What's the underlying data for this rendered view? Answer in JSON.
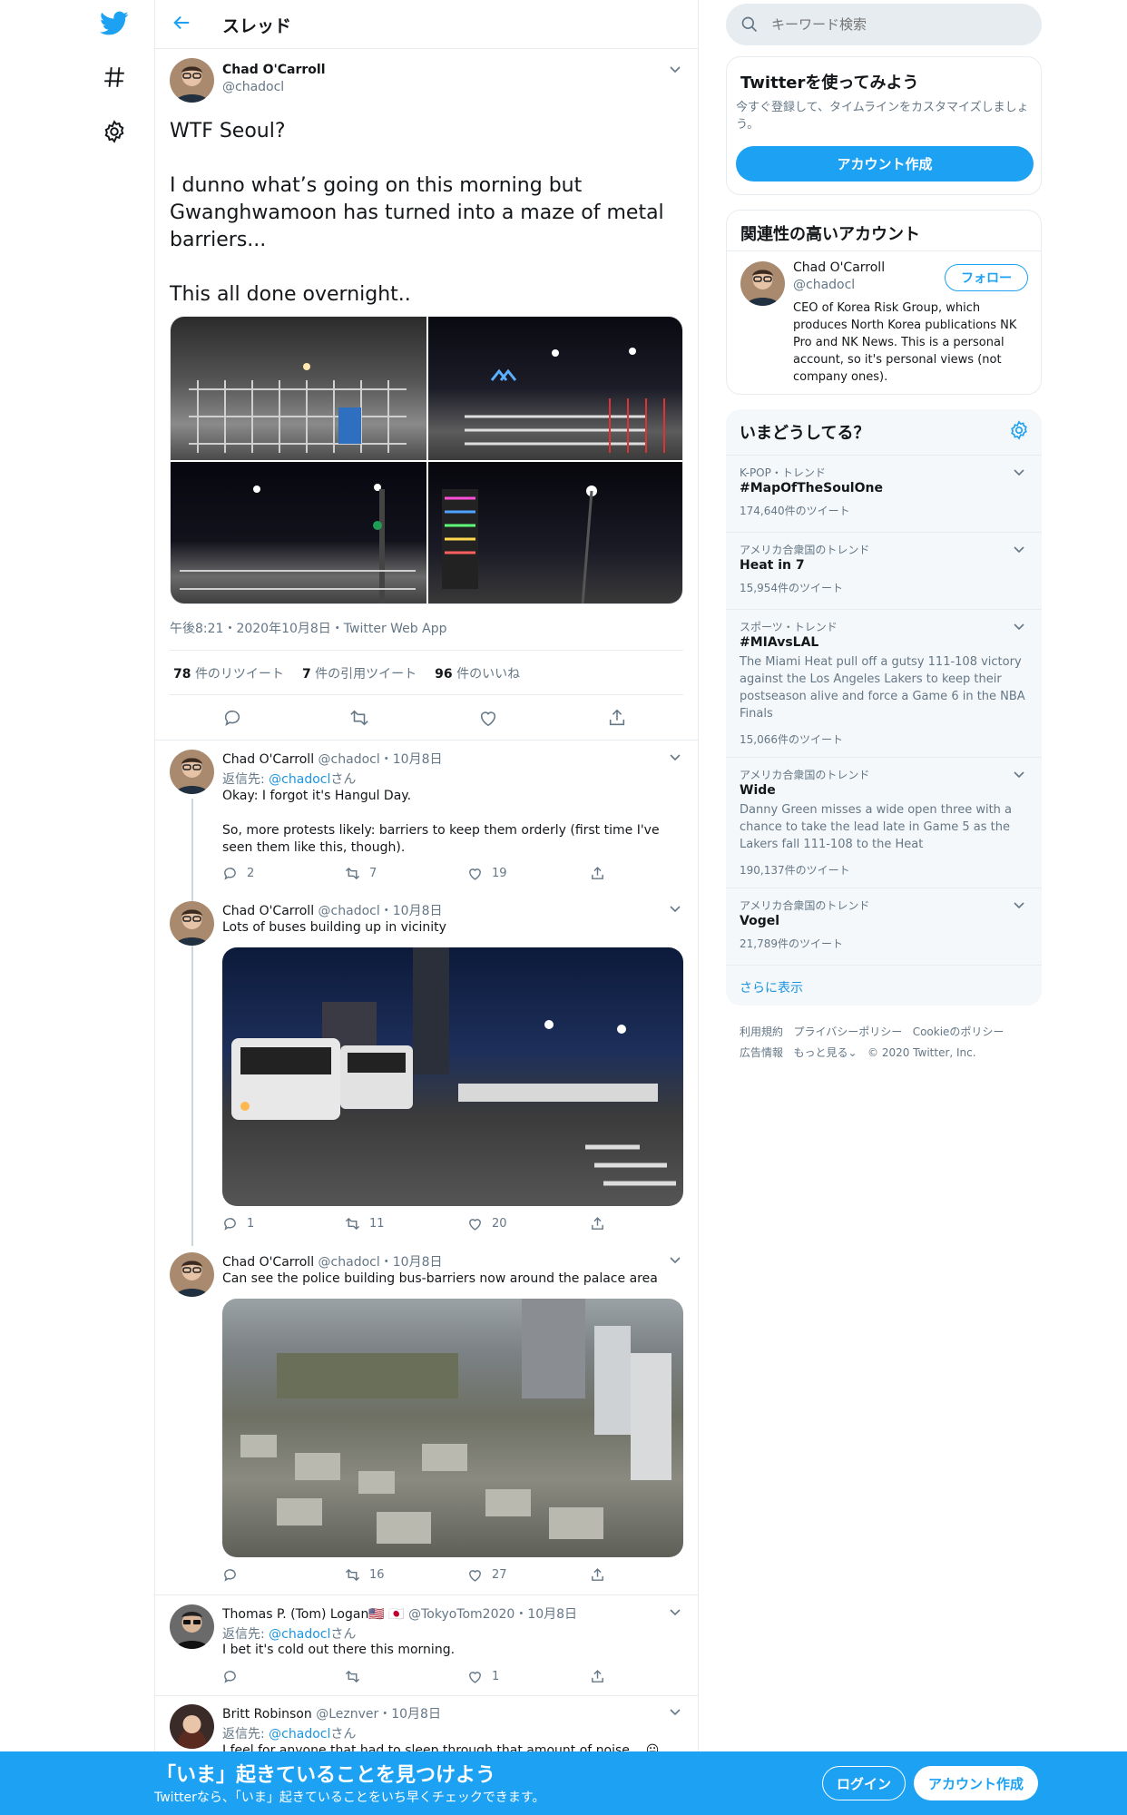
{
  "header": {
    "title": "スレッド"
  },
  "search": {
    "placeholder": "キーワード検索"
  },
  "main_tweet": {
    "name": "Chad O'Carroll",
    "handle": "@chadocl",
    "text_1": "WTF Seoul?",
    "text_2": "I dunno what’s going on this morning but Gwanghwamoon has turned into a maze of metal barriers...",
    "text_3": "This all done overnight..",
    "meta": "午後8:21・2020年10月8日・Twitter Web App",
    "stats": {
      "retweets_num": "78",
      "retweets_label": "件のリツイート",
      "quotes_num": "7",
      "quotes_label": "件の引用ツイート",
      "likes_num": "96",
      "likes_label": "件のいいね"
    }
  },
  "replies": [
    {
      "name": "Chad O'Carroll",
      "handle": "@chadocl",
      "date": "10月8日",
      "reply_prefix": "返信先:",
      "reply_to": "@chadocl",
      "reply_suffix": "さん",
      "text_1": "Okay: I forgot it's Hangul Day.",
      "text_2": "So, more protests likely: barriers to keep them orderly (first time I've seen them like this, though).",
      "replies": "2",
      "retweets": "7",
      "likes": "19"
    },
    {
      "name": "Chad O'Carroll",
      "handle": "@chadocl",
      "date": "10月8日",
      "text_1": "Lots of buses building up in vicinity",
      "replies": "1",
      "retweets": "11",
      "likes": "20"
    },
    {
      "name": "Chad O'Carroll",
      "handle": "@chadocl",
      "date": "10月8日",
      "text_1": "Can see the police building bus-barriers now around the palace area",
      "replies": "",
      "retweets": "16",
      "likes": "27"
    },
    {
      "name": "Thomas P. (Tom) Logan",
      "flags": "🇺🇸 🇯🇵",
      "handle": "@TokyoTom2020",
      "date": "10月8日",
      "reply_prefix": "返信先:",
      "reply_to": "@chadocl",
      "reply_suffix": "さん",
      "text_1": "I bet it's cold out there this morning.",
      "replies": "",
      "retweets": "",
      "likes": "1"
    },
    {
      "name": "Britt Robinson",
      "handle": "@Leznver",
      "date": "10月8日",
      "reply_prefix": "返信先:",
      "reply_to": "@chadocl",
      "reply_suffix": "さん",
      "text_1": "I feel for anyone that had to sleep through that amount of noise... 😐"
    }
  ],
  "signup_card": {
    "title": "Twitterを使ってみよう",
    "desc": "今すぐ登録して、タイムラインをカスタマイズしましょう。",
    "button": "アカウント作成"
  },
  "related": {
    "title": "関連性の高いアカウント",
    "name": "Chad O'Carroll",
    "handle": "@chadocl",
    "follow": "フォロー",
    "bio": "CEO of Korea Risk Group, which produces North Korea publications NK Pro and NK News. This is a personal account, so it's personal views (not company ones)."
  },
  "trends": {
    "title": "いまどうしてる？",
    "items": [
      {
        "context": "K-POP・トレンド",
        "name": "#MapOfTheSoulOne",
        "desc": "",
        "count": "174,640件のツイート"
      },
      {
        "context": "アメリカ合衆国のトレンド",
        "name": "Heat in 7",
        "desc": "",
        "count": "15,954件のツイート"
      },
      {
        "context": "スポーツ・トレンド",
        "name": "#MIAvsLAL",
        "desc": "The Miami Heat pull off a gutsy 111-108 victory against the Los Angeles Lakers to keep their postseason alive and force a Game 6 in the NBA Finals",
        "count": "15,066件のツイート"
      },
      {
        "context": "アメリカ合衆国のトレンド",
        "name": "Wide",
        "desc": "Danny Green misses a wide open three with a chance to take the lead late in Game 5 as the Lakers fall 111-108 to the Heat",
        "count": "190,137件のツイート"
      },
      {
        "context": "アメリカ合衆国のトレンド",
        "name": "Vogel",
        "desc": "",
        "count": "21,789件のツイート"
      }
    ],
    "more": "さらに表示"
  },
  "footer": {
    "terms": "利用規約",
    "privacy": "プライバシーポリシー",
    "cookie": "Cookieのポリシー",
    "ads": "広告情報",
    "more": "もっと見る",
    "copyright": "© 2020 Twitter, Inc."
  },
  "bottom_bar": {
    "title": "「いま」起きていることを見つけよう",
    "subtitle": "Twitterなら、「いま」起きていることをいち早くチェックできます。",
    "login": "ログイン",
    "signup": "アカウント作成"
  },
  "colors": {
    "accent": "#1da1f2",
    "muted": "#657786",
    "border": "#e6ecf0"
  }
}
